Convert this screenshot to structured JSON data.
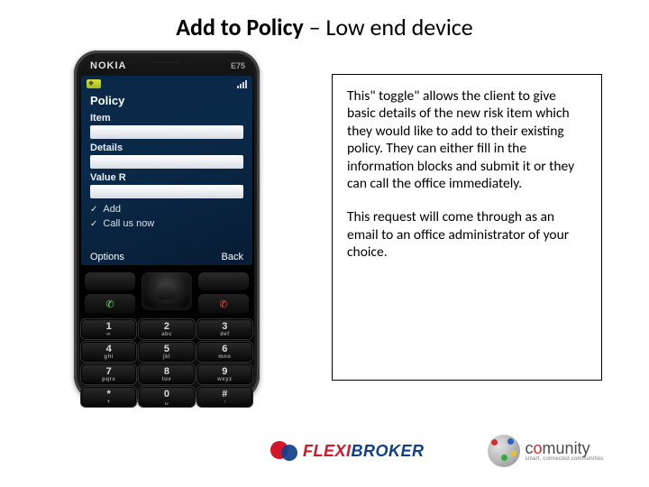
{
  "title": {
    "bold": "Add to Policy",
    "rest": " – Low end device"
  },
  "phone": {
    "brand": "NOKIA",
    "model": "E75",
    "screen": {
      "title": "Policy",
      "fields": [
        {
          "label": "Item"
        },
        {
          "label": "Details"
        },
        {
          "label": "Value R"
        }
      ],
      "menu": [
        {
          "icon": "✓",
          "label": "Add"
        },
        {
          "icon": "✓",
          "label": "Call us now"
        }
      ],
      "softkeys": {
        "left": "Options",
        "right": "Back"
      }
    },
    "nav": {
      "call_glyph": "✆",
      "end_glyph": "✆"
    },
    "keys": [
      {
        "d": "1",
        "l": "∞"
      },
      {
        "d": "2",
        "l": "abc"
      },
      {
        "d": "3",
        "l": "def"
      },
      {
        "d": "4",
        "l": "ghi"
      },
      {
        "d": "5",
        "l": "jkl"
      },
      {
        "d": "6",
        "l": "mno"
      },
      {
        "d": "7",
        "l": "pqrs"
      },
      {
        "d": "8",
        "l": "tuv"
      },
      {
        "d": "9",
        "l": "wxyz"
      },
      {
        "d": "*",
        "l": "+"
      },
      {
        "d": "0",
        "l": "␣"
      },
      {
        "d": "#",
        "l": "↑"
      }
    ]
  },
  "explain": {
    "p1": " This\" toggle\" allows the client to give basic details of the new risk item which they would like to add to their existing policy.  They can either fill in the information blocks and submit it or they can call the office immediately.",
    "p2": "This request will come through as an email to an office administrator of your choice."
  },
  "logos": {
    "flexi": {
      "part1": "FLEXI",
      "part2": "BROKER"
    },
    "comunity": {
      "pre": "c",
      "o": "o",
      "post": "munity",
      "tagline": "smart, connected communities"
    }
  }
}
